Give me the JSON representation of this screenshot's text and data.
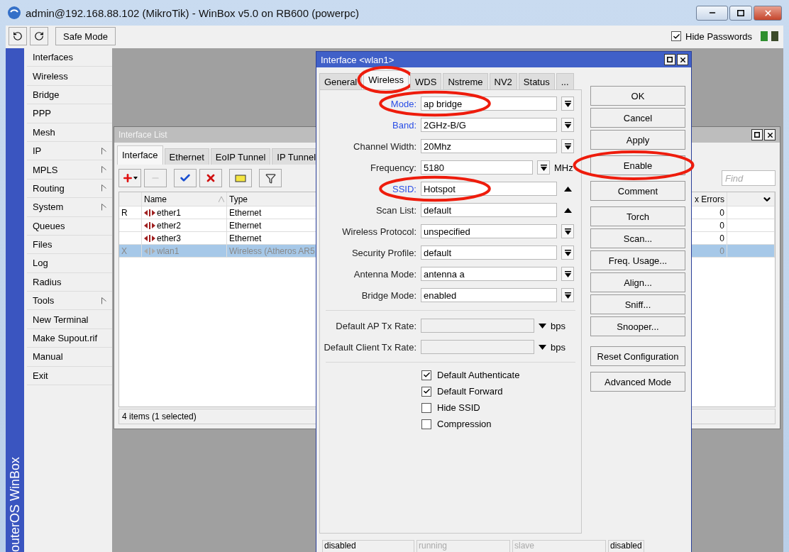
{
  "window": {
    "title": "admin@192.168.88.102 (MikroTik) - WinBox v5.0 on RB600 (powerpc)"
  },
  "toolbar": {
    "safe_mode": "Safe Mode",
    "hide_passwords": {
      "label": "Hide Passwords",
      "checked": true
    }
  },
  "sidebar": {
    "brand": "outerOS WinBox",
    "items": [
      {
        "label": "Interfaces",
        "submenu": false
      },
      {
        "label": "Wireless",
        "submenu": false
      },
      {
        "label": "Bridge",
        "submenu": false
      },
      {
        "label": "PPP",
        "submenu": false
      },
      {
        "label": "Mesh",
        "submenu": false
      },
      {
        "label": "IP",
        "submenu": true
      },
      {
        "label": "MPLS",
        "submenu": true
      },
      {
        "label": "Routing",
        "submenu": true
      },
      {
        "label": "System",
        "submenu": true
      },
      {
        "label": "Queues",
        "submenu": false
      },
      {
        "label": "Files",
        "submenu": false
      },
      {
        "label": "Log",
        "submenu": false
      },
      {
        "label": "Radius",
        "submenu": false
      },
      {
        "label": "Tools",
        "submenu": true
      },
      {
        "label": "New Terminal",
        "submenu": false
      },
      {
        "label": "Make Supout.rif",
        "submenu": false
      },
      {
        "label": "Manual",
        "submenu": false
      },
      {
        "label": "Exit",
        "submenu": false
      }
    ]
  },
  "interface_list": {
    "title": "Interface List",
    "tabs": [
      {
        "label": "Interface",
        "selected": true
      },
      {
        "label": "Ethernet",
        "selected": false
      },
      {
        "label": "EoIP Tunnel",
        "selected": false
      },
      {
        "label": "IP Tunnel",
        "selected": false
      }
    ],
    "find_placeholder": "Find",
    "columns": {
      "name": "Name",
      "type": "Type",
      "errors": "x Errors"
    },
    "rows": [
      {
        "flag": "R",
        "name": "ether1",
        "type": "Ethernet",
        "errors": "0",
        "selected": false,
        "disabled": false
      },
      {
        "name": "ether2",
        "type": "Ethernet",
        "errors": "0",
        "selected": false,
        "disabled": false
      },
      {
        "name": "ether3",
        "type": "Ethernet",
        "errors": "0",
        "selected": false,
        "disabled": false
      },
      {
        "flag": "X",
        "name": "wlan1",
        "type": "Wireless (Atheros AR5",
        "errors": "0",
        "selected": true,
        "disabled": true
      }
    ],
    "footer": "4 items (1 selected)"
  },
  "dialog": {
    "title": "Interface <wlan1>",
    "tabs": [
      {
        "label": "General",
        "selected": false,
        "circled": false
      },
      {
        "label": "Wireless",
        "selected": true,
        "circled": true
      },
      {
        "label": "WDS",
        "selected": false,
        "circled": false
      },
      {
        "label": "Nstreme",
        "selected": false,
        "circled": false
      },
      {
        "label": "NV2",
        "selected": false,
        "circled": false
      },
      {
        "label": "Status",
        "selected": false,
        "circled": false
      },
      {
        "label": "...",
        "selected": false,
        "circled": false
      }
    ],
    "fields": [
      {
        "kind": "dropdown",
        "label": "Mode:",
        "value": "ap bridge",
        "link": true,
        "circled": true
      },
      {
        "kind": "dropdown",
        "label": "Band:",
        "value": "2GHz-B/G",
        "link": true,
        "circled": false
      },
      {
        "kind": "dropdown",
        "label": "Channel Width:",
        "value": "20Mhz",
        "link": false,
        "circled": false
      },
      {
        "kind": "dropdown",
        "label": "Frequency:",
        "value": "5180",
        "unit": "MHz",
        "link": false,
        "circled": false
      },
      {
        "kind": "combo",
        "label": "SSID:",
        "value": "Hotspot",
        "link": true,
        "circled": true
      },
      {
        "kind": "combo",
        "label": "Scan List:",
        "value": "default",
        "link": false,
        "circled": false
      },
      {
        "kind": "dropdown",
        "label": "Wireless Protocol:",
        "value": "unspecified",
        "link": false,
        "circled": false
      },
      {
        "kind": "dropdown",
        "label": "Security Profile:",
        "value": "default",
        "link": false,
        "circled": false
      },
      {
        "kind": "dropdown",
        "label": "Antenna Mode:",
        "value": "antenna a",
        "link": false,
        "circled": false
      },
      {
        "kind": "dropdown",
        "label": "Bridge Mode:",
        "value": "enabled",
        "link": false,
        "circled": false
      }
    ],
    "rates": [
      {
        "label": "Default AP Tx Rate:",
        "unit": "bps"
      },
      {
        "label": "Default Client Tx Rate:",
        "unit": "bps"
      }
    ],
    "checkboxes": [
      {
        "label": "Default Authenticate",
        "checked": true
      },
      {
        "label": "Default Forward",
        "checked": true
      },
      {
        "label": "Hide SSID",
        "checked": false
      },
      {
        "label": "Compression",
        "checked": false
      }
    ],
    "button_groups": [
      [
        {
          "label": "OK",
          "circled": false
        },
        {
          "label": "Cancel",
          "circled": false
        },
        {
          "label": "Apply",
          "circled": false
        },
        {
          "label": "Enable",
          "circled": true
        },
        {
          "label": "Comment",
          "circled": false
        }
      ],
      [
        {
          "label": "Torch",
          "circled": false
        },
        {
          "label": "Scan...",
          "circled": false
        },
        {
          "label": "Freq. Usage...",
          "circled": false
        },
        {
          "label": "Align...",
          "circled": false
        },
        {
          "label": "Sniff...",
          "circled": false
        },
        {
          "label": "Snooper...",
          "circled": false
        }
      ],
      [
        {
          "label": "Reset Configuration",
          "circled": false
        }
      ],
      [
        {
          "label": "Advanced Mode",
          "circled": false
        }
      ]
    ],
    "status": [
      {
        "text": "disabled",
        "active": true
      },
      {
        "text": "running",
        "active": false
      },
      {
        "text": "slave",
        "active": false
      },
      {
        "text": "disabled",
        "active": true
      }
    ]
  }
}
